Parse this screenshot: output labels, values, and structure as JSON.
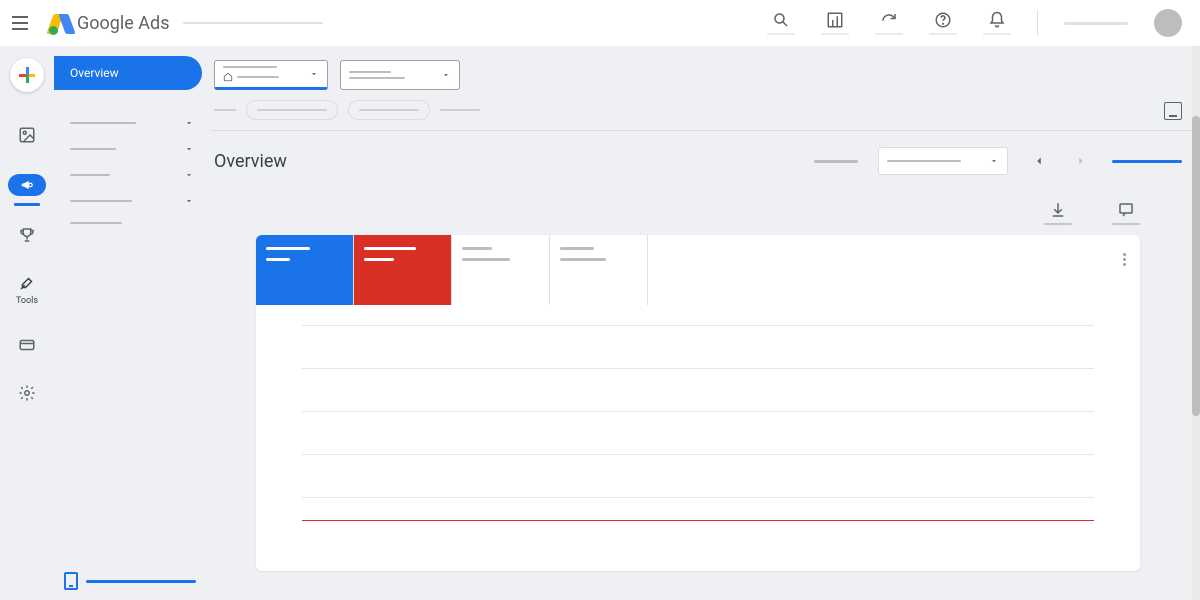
{
  "header": {
    "product_name_1": "Google",
    "product_name_2": "Ads"
  },
  "left_rail": {
    "items": [
      {
        "name": "overview-icon",
        "label": ""
      },
      {
        "name": "campaigns-icon",
        "label": "",
        "active": true
      },
      {
        "name": "goals-icon",
        "label": ""
      },
      {
        "name": "tools-icon",
        "label": "Tools"
      },
      {
        "name": "billing-icon",
        "label": ""
      },
      {
        "name": "settings-icon",
        "label": ""
      }
    ]
  },
  "left_nav": {
    "active_label": "Overview",
    "rows": [
      "",
      "",
      "",
      "",
      ""
    ]
  },
  "page": {
    "title": "Overview"
  },
  "metrics": [
    {
      "color": "blue"
    },
    {
      "color": "red"
    },
    {
      "color": "plain"
    },
    {
      "color": "plain"
    }
  ]
}
